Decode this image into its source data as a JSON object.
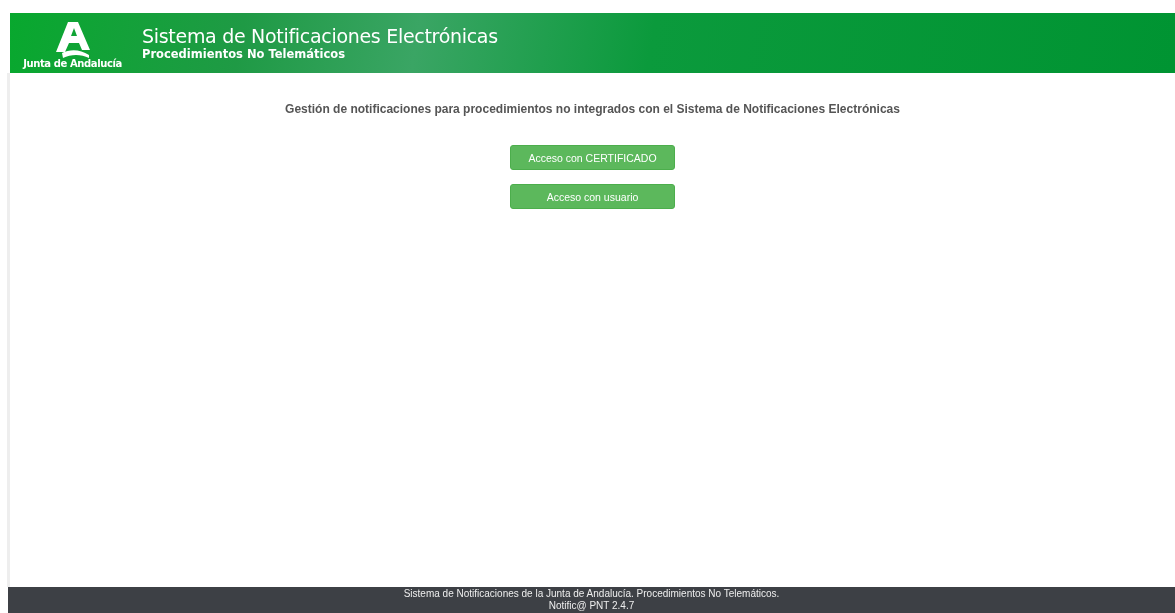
{
  "header": {
    "logo_text": "Junta de Andalucía",
    "title": "Sistema de Notificaciones Electrónicas",
    "subtitle": "Procedimientos No Telemáticos"
  },
  "main": {
    "heading": "Gestión de notificaciones para procedimientos no integrados con el Sistema de Notificaciones Electrónicas",
    "buttons": [
      "Acceso con CERTIFICADO",
      "Acceso con usuario"
    ]
  },
  "footer": {
    "lines": [
      "Sistema de Notificaciones de la Junta de Andalucía. Procedimientos No Telemáticos.",
      "Notific@ PNT 2.4.7"
    ]
  }
}
